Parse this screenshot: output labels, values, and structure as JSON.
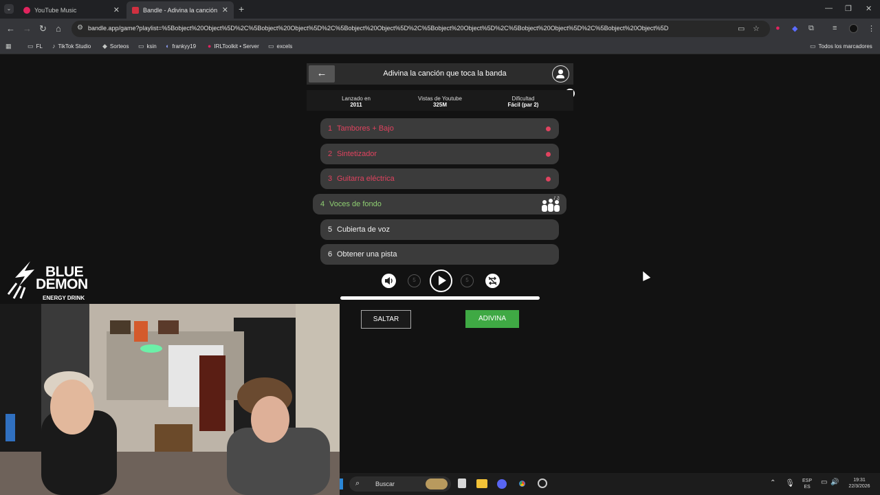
{
  "browser": {
    "tabs": [
      {
        "title": "YouTube Music",
        "active": false
      },
      {
        "title": "Bandle - Adivina la canción, un",
        "active": true
      }
    ],
    "url": "bandle.app/game?playlist=%5Bobject%20Object%5D%2C%5Bobject%20Object%5D%2C%5Bobject%20Object%5D%2C%5Bobject%20Object%5D%2C%5Bobject%20Object%5D%2C%5Bobject%20Object%5D",
    "bookmarks": [
      "FL",
      "TikTok Studio",
      "Sorteos",
      "ksin",
      "frankyy19",
      "IRLToolkit • Server",
      "excels"
    ],
    "all_bookmarks": "Todos los marcadores"
  },
  "game": {
    "title": "Adivina la canción que toca la banda",
    "stats": [
      {
        "label": "Lanzado en",
        "value": "2011"
      },
      {
        "label": "Vistas de Youtube",
        "value": "325M"
      },
      {
        "label": "Dificultad",
        "value": "Fácil (par 2)"
      }
    ],
    "rows": [
      {
        "num": "1",
        "label": "Tambores + Bajo",
        "state": "wrong"
      },
      {
        "num": "2",
        "label": "Sintetizador",
        "state": "wrong"
      },
      {
        "num": "3",
        "label": "Guitarra eléctrica",
        "state": "wrong"
      },
      {
        "num": "4",
        "label": "Voces de fondo",
        "state": "current"
      },
      {
        "num": "5",
        "label": "Cubierta de voz",
        "state": "locked"
      },
      {
        "num": "6",
        "label": "Obtener una pista",
        "state": "locked"
      }
    ],
    "rewind_seconds": "5",
    "forward_seconds": "5",
    "progress": 1.0,
    "skip_label": "SALTAR",
    "guess_label": "ADIVINA"
  },
  "overlay": {
    "logo_line1": "BLUE",
    "logo_line2": "DEMON",
    "logo_line3": "ENERGY DRINK"
  },
  "taskbar": {
    "search_label": "Buscar",
    "lang_top": "ESP",
    "lang_bottom": "ES",
    "time": "19:31",
    "date": "22/3/2026"
  },
  "colors": {
    "wrong": "#e0435f",
    "current": "#8fcf72",
    "guess_button": "#3fa944"
  }
}
